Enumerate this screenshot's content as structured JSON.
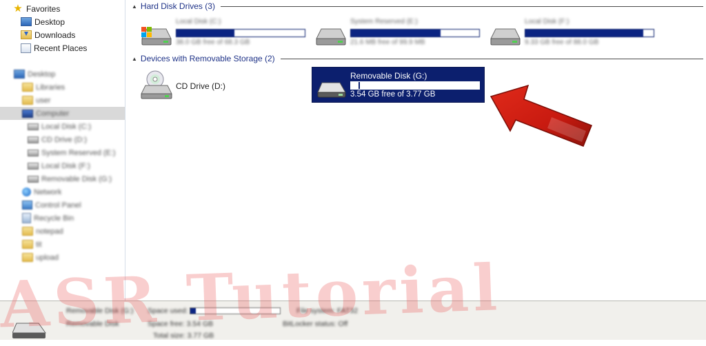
{
  "nav": {
    "favorites": {
      "label": "Favorites"
    },
    "items": [
      {
        "label": "Desktop"
      },
      {
        "label": "Downloads"
      },
      {
        "label": "Recent Places"
      }
    ],
    "tree_blurred": [
      "Desktop",
      "Libraries",
      "user",
      "Computer",
      "Local Disk (C:)",
      "CD Drive (D:)",
      "System Reserved (E:)",
      "Local Disk (F:)",
      "Removable Disk (G:)",
      "Network",
      "Control Panel",
      "Recycle Bin",
      "notepad",
      "tit",
      "upload"
    ]
  },
  "groups": {
    "hard_disks": {
      "label": "Hard Disk Drives (3)"
    },
    "removable": {
      "label": "Devices with Removable Storage (2)"
    }
  },
  "drives": [
    {
      "name": "Local Disk (C:)",
      "free": "38.0 GB free of 68.3 GB",
      "fill": 0.45
    },
    {
      "name": "System Reserved (E:)",
      "free": "21.6 MB free of 99.9 MB",
      "fill": 0.7
    },
    {
      "name": "Local Disk (F:)",
      "free": "9.33 GB free of 88.0 GB",
      "fill": 0.92
    }
  ],
  "removable_drives": [
    {
      "name": "CD Drive (D:)"
    },
    {
      "name": "Removable Disk (G:)",
      "free": "3.54 GB free of 3.77 GB",
      "fill": 0.06
    }
  ],
  "details": {
    "title": "Removable Disk (G:)",
    "type": "Removable Disk",
    "space_used_label": "Space used:",
    "space_used_fill": 0.06,
    "space_free": "Space free: 3.54 GB",
    "total_size": "Total size: 3.77 GB",
    "file_system": "File system: FAT32",
    "bitlocker": "BitLocker status: Off"
  },
  "watermark": {
    "text": "ASR Tutorial"
  },
  "colors": {
    "selection": "#0c1f6e",
    "bar_fill": "#0b2482",
    "header_text": "#1e3287",
    "arrow": "#d01f14"
  }
}
